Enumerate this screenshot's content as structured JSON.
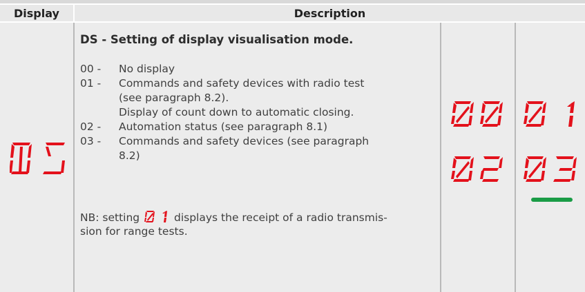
{
  "header": {
    "display_label": "Display",
    "description_label": "Description"
  },
  "display_code": "DS",
  "description": {
    "title": "DS - Setting of display visualisation mode.",
    "items": [
      {
        "code": "00 -",
        "lines": [
          "No display"
        ]
      },
      {
        "code": "01 -",
        "lines": [
          "Commands and safety devices with radio test",
          "(see paragraph 8.2).",
          "Display of count down to automatic closing."
        ]
      },
      {
        "code": "02 -",
        "lines": [
          "Automation status (see paragraph 8.1)"
        ]
      },
      {
        "code": "03 -",
        "lines": [
          "Commands and safety devices (see paragraph",
          "8.2)"
        ]
      }
    ],
    "nb_prefix": "NB: setting",
    "nb_value": "01",
    "nb_suffix": "displays the receipt of a radio transmis-",
    "nb_line2": "sion for range tests."
  },
  "options": [
    "00",
    "01",
    "02",
    "03"
  ],
  "default_option": "03",
  "colors": {
    "segment": "#e3111b",
    "default_marker": "#1a9c46"
  }
}
